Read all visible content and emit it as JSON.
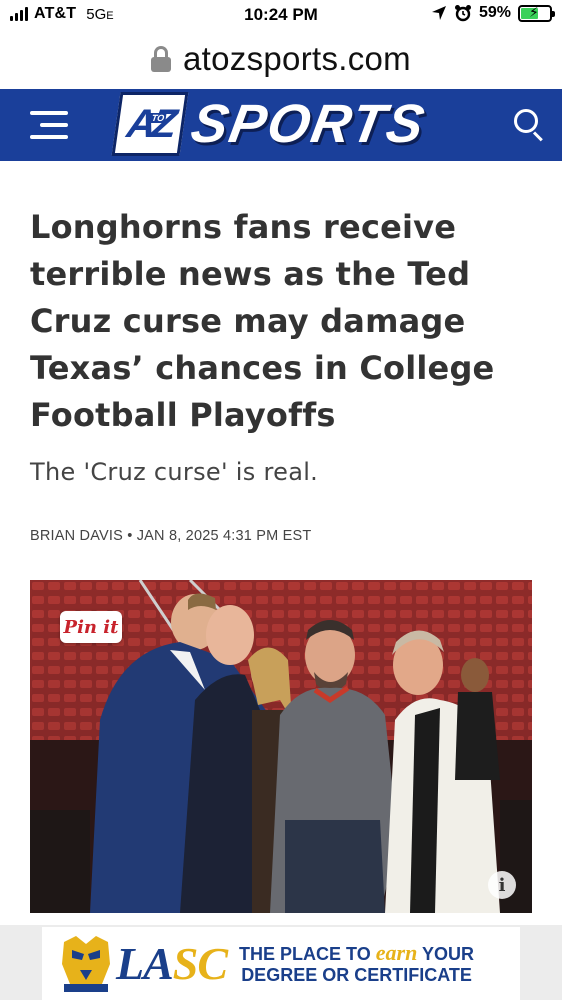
{
  "status_bar": {
    "carrier": "AT&T",
    "network": "5G",
    "network_suffix": "E",
    "time": "10:24 PM",
    "battery_percent": "59%",
    "battery_level": 0.59,
    "battery_color": "#3bd15a"
  },
  "browser": {
    "url": "atozsports.com"
  },
  "header": {
    "logo_box_text": "AZ",
    "logo_box_small": "TO",
    "logo_word": "SPORTS",
    "background_color": "#1a3f9a"
  },
  "article": {
    "headline": "Longhorns fans receive terrible news as the Ted Cruz curse may damage Texas’ chances in College Football Playoffs",
    "subhead": "The 'Cruz curse' is real.",
    "author": "BRIAN DAVIS",
    "separator": "•",
    "date": "JAN 8, 2025 4:31 PM EST"
  },
  "photo": {
    "pin_label": "Pin it",
    "info_label": "i"
  },
  "ad": {
    "logo_la": "LA",
    "logo_sc": "SC",
    "tag_part1": "THE PLACE TO",
    "tag_earn": "earn",
    "tag_part2": "YOUR",
    "tag_line2": "DEGREE OR CERTIFICATE",
    "brand_color": "#1a3f8a",
    "accent_color": "#e7b21a"
  }
}
